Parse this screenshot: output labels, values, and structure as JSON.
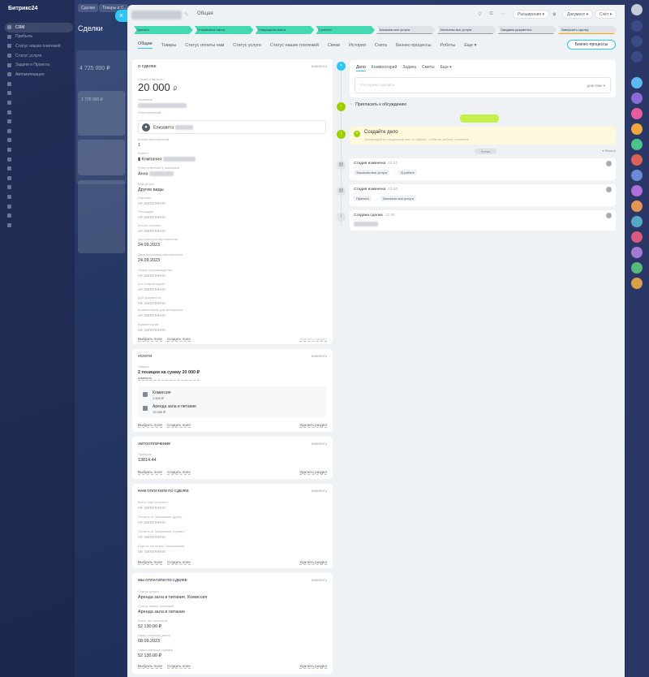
{
  "portal": {
    "logo": "Битрикс24",
    "menu": [
      "CRM",
      "Прибыль",
      "Статус наших платежей",
      "Статус услуги",
      "Задачи и Проекты",
      "Автоматизация",
      "",
      "",
      "",
      "",
      "",
      "",
      "",
      "",
      "",
      "",
      "",
      "",
      "",
      "",
      "",
      "",
      "",
      ""
    ],
    "top_tabs": [
      "Сделки",
      "Товары и С..."
    ],
    "page_title": "Сделки",
    "column_total": "4 725 000 ₽",
    "card_sum": "1 725 000 ₽"
  },
  "deal": {
    "funnel": "Общая",
    "header_buttons": {
      "extensions": "Расширения",
      "documents": "Документ",
      "invoice": "Счёт"
    },
    "stages": [
      {
        "label": "Принята",
        "state": "done"
      },
      {
        "label": "Отправлена смета",
        "state": "done"
      },
      {
        "label": "Утверждена смета",
        "state": "done"
      },
      {
        "label": "В работе",
        "state": "done"
      },
      {
        "label": "Заказаны все услуги",
        "state": "todo"
      },
      {
        "label": "Оплачены все услуги",
        "state": "todo"
      },
      {
        "label": "Ожидаем документы",
        "state": "todo"
      },
      {
        "label": "Завершить сделку",
        "state": "last"
      }
    ],
    "tabs": [
      "Общие",
      "Товары",
      "Статус оплаты нам",
      "Статус услуги",
      "Статус наших платежей",
      "Связи",
      "История",
      "Счета",
      "Бизнес-процессы",
      "Роботы",
      "Еще"
    ],
    "bp_button": "Бизнес-процессы"
  },
  "about": {
    "title": "О сделке",
    "edit": "изменить",
    "sum_label": "Сумма и валюта",
    "sum_value": "20 000",
    "currency": "₽",
    "name_label": "Название",
    "responsible_label": "Ответственный",
    "responsible_name": "Елизавета",
    "count_label": "Кол-во мероприятий",
    "count_value": "1",
    "client_label": "Клиент",
    "client_value": "Компания",
    "contact_label": "Ответственный у заказчика",
    "contact_value": "Анна",
    "service_label": "Вид услуги",
    "service_value": "Другие виды",
    "partner_label": "Партнер",
    "empty": "не заполнено",
    "venue_label": "Площадка",
    "people_label": "Кол-во человек",
    "date_label": "Дата начала мероприятия",
    "date_value": "24.09.2023",
    "date_end_label": "Дата окончания мероприятия",
    "date_end_value": "24.09.2023",
    "escort_label": "Нужно сопровождение",
    "escort_who_label": "Кто сопровождает",
    "docs_label": "Доп документы",
    "comment_label": "Комментарий для менеджера",
    "ext_comment_label": "Комментарий",
    "select_field": "Выбрать поле",
    "create_field": "Создать поле",
    "delete_section": "Удалить раздел"
  },
  "services": {
    "title": "Услуги",
    "edit": "изменить",
    "goods_label": "Товары",
    "summary": "2 позиции на сумму 20 000 ₽",
    "change": "изменить",
    "items": [
      {
        "name": "Комиссия",
        "price": "2 500 ₽"
      },
      {
        "name": "Аренда зала и питание",
        "price": "15 000 ₽"
      }
    ]
  },
  "auto": {
    "title": "Автоопличение",
    "edit": "изменить",
    "profit_label": "Прибыль",
    "profit_value": "13814.44"
  },
  "paid_us": {
    "title": "Нам оплатили по сделке",
    "edit": "изменить",
    "f1": "Всего нам оплачено",
    "f2": "Оплаты от Заказчиков (даты)",
    "f3": "Оплаты от Заказчиков (суммы)",
    "f4": "Еще не оплачено Заказчиками"
  },
  "we_paid": {
    "title": "Мы оплатили по сделке",
    "edit": "изменить",
    "f1": "Статус услуги",
    "v1": "Аренда зала и питание, Комиссия",
    "f2": "Статус наших платежей",
    "v2": "Аренда зала и питание",
    "f3": "Всего мы оплатили",
    "v3": "52 130.00 ₽",
    "f4": "Наши платежи (даты)",
    "v4": "08.09.2023",
    "f5": "Наши платежи (суммы)",
    "v5": "52 130.00 ₽"
  },
  "timeline": {
    "editor_tabs": [
      "Дело",
      "Комментарий",
      "Задача",
      "Сметы",
      "Еще"
    ],
    "placeholder": "Что нужно сделать",
    "action": "действие",
    "invite": "Пригласить к обсуждению",
    "create_title": "Создайте дело",
    "create_sub": "Запланируйте следующий шаг по сделке, чтобы не забыть о клиенте",
    "today": "Вчера",
    "filter": "Фильтр",
    "events": [
      {
        "title": "Стадия изменена",
        "time": "13:41",
        "from": "Заказаны все услуги",
        "to": "В работе"
      },
      {
        "title": "Стадия изменена",
        "time": "13:40",
        "from": "Принята",
        "to": "Заказаны все услуги"
      },
      {
        "title": "Создана сделка",
        "time": "12:36"
      }
    ]
  },
  "colors": {
    "accent": "#2fc6f6",
    "stage_done": "#44d9b3",
    "activity_green": "#bbed21",
    "todo_bg": "#fef9dd"
  }
}
